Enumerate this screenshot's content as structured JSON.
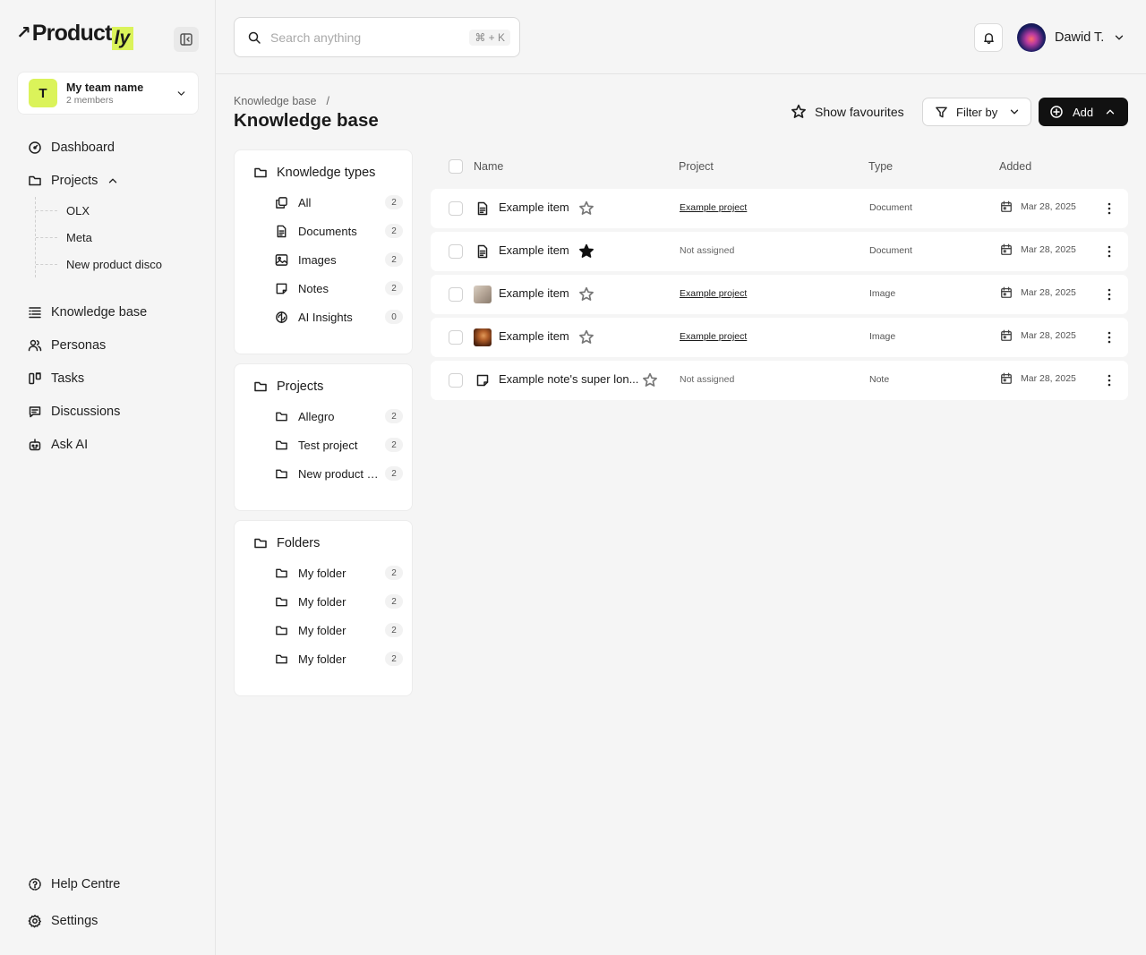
{
  "brand": {
    "logo_main": "Product",
    "logo_accent": "ly"
  },
  "team": {
    "initial": "T",
    "name": "My team name",
    "members": "2 members"
  },
  "nav": {
    "dashboard": "Dashboard",
    "projects": "Projects",
    "project_items": [
      "OLX",
      "Meta",
      "New product disco"
    ],
    "knowledge_base": "Knowledge base",
    "personas": "Personas",
    "tasks": "Tasks",
    "discussions": "Discussions",
    "ask_ai": "Ask AI",
    "help": "Help Centre",
    "settings": "Settings"
  },
  "search": {
    "placeholder": "Search anything",
    "shortcut": "⌘ + K"
  },
  "user": {
    "name": "Dawid T."
  },
  "breadcrumb": {
    "root": "Knowledge base",
    "sep": "/"
  },
  "page": {
    "title": "Knowledge base"
  },
  "actions": {
    "favourites": "Show favourites",
    "filter": "Filter by",
    "add": "Add"
  },
  "knowledge_types": {
    "title": "Knowledge types",
    "items": [
      {
        "label": "All",
        "count": "2",
        "icon": "copy-icon"
      },
      {
        "label": "Documents",
        "count": "2",
        "icon": "document-icon"
      },
      {
        "label": "Images",
        "count": "2",
        "icon": "image-icon"
      },
      {
        "label": "Notes",
        "count": "2",
        "icon": "note-icon"
      },
      {
        "label": "AI Insights",
        "count": "0",
        "icon": "brain-icon"
      }
    ]
  },
  "projects_panel": {
    "title": "Projects",
    "items": [
      {
        "label": "Allegro",
        "count": "2"
      },
      {
        "label": "Test project",
        "count": "2"
      },
      {
        "label": "New product d...",
        "count": "2"
      }
    ]
  },
  "folders_panel": {
    "title": "Folders",
    "items": [
      {
        "label": "My folder",
        "count": "2"
      },
      {
        "label": "My folder",
        "count": "2"
      },
      {
        "label": "My folder",
        "count": "2"
      },
      {
        "label": "My folder",
        "count": "2"
      }
    ]
  },
  "table": {
    "headers": {
      "name": "Name",
      "project": "Project",
      "type": "Type",
      "added": "Added"
    },
    "rows": [
      {
        "name": "Example item",
        "favourite": false,
        "project": "Example project",
        "type": "Document",
        "added": "Mar 28, 2025"
      },
      {
        "name": "Example item",
        "favourite": true,
        "project": "Not assigned",
        "type": "Document",
        "added": "Mar 28, 2025"
      },
      {
        "name": "Example item",
        "favourite": false,
        "project": "Example project",
        "type": "Image",
        "added": "Mar 28, 2025"
      },
      {
        "name": "Example item",
        "favourite": false,
        "project": "Example project",
        "type": "Image",
        "added": "Mar 28, 2025"
      },
      {
        "name": "Example note's super lon...",
        "favourite": false,
        "project": "Not assigned",
        "type": "Note",
        "added": "Mar 28, 2025"
      }
    ]
  },
  "colors": {
    "accent": "#dbf35a",
    "primary_button": "#111111",
    "background": "#f5f5f5"
  }
}
